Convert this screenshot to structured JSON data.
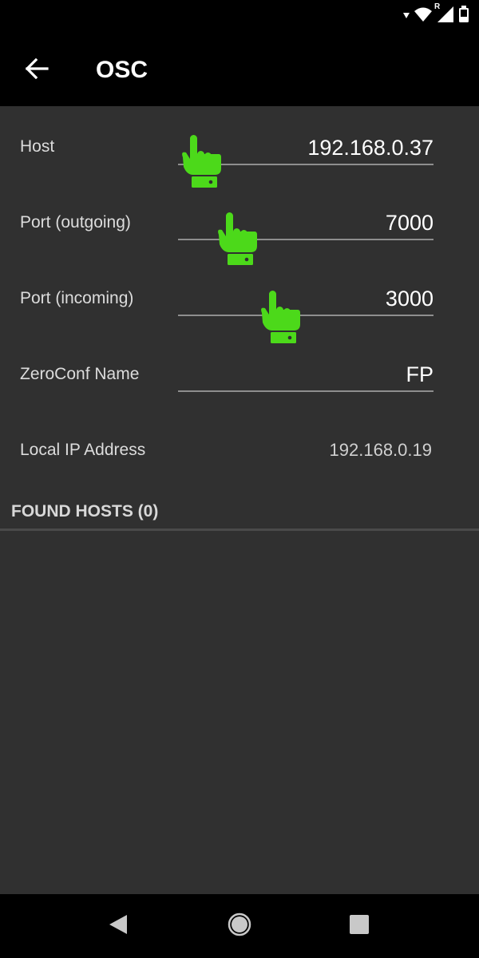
{
  "status_bar": {
    "icons": [
      "data-arrow-icon",
      "wifi-icon",
      "signal-roaming-icon",
      "battery-icon"
    ],
    "roaming_letter": "R"
  },
  "app_bar": {
    "title": "OSC",
    "back_icon": "arrow-left-icon"
  },
  "settings": {
    "host": {
      "label": "Host",
      "value": "192.168.0.37"
    },
    "port_outgoing": {
      "label": "Port (outgoing)",
      "value": "7000"
    },
    "port_incoming": {
      "label": "Port (incoming)",
      "value": "3000"
    },
    "zeroconf_name": {
      "label": "ZeroConf Name",
      "value": "FP"
    },
    "local_ip": {
      "label": "Local IP Address",
      "value": "192.168.0.19"
    }
  },
  "found_hosts": {
    "header": "FOUND HOSTS (0)",
    "items": []
  },
  "overlay": {
    "pointer_icon": "pointing-hand-icon",
    "pointer_color": "#4cd91a"
  },
  "nav_bar": {
    "back_icon": "nav-back-icon",
    "home_icon": "nav-home-icon",
    "recents_icon": "nav-recents-icon"
  },
  "colors": {
    "background": "#303030",
    "bar": "#000000",
    "underline": "#8e8e8e"
  }
}
